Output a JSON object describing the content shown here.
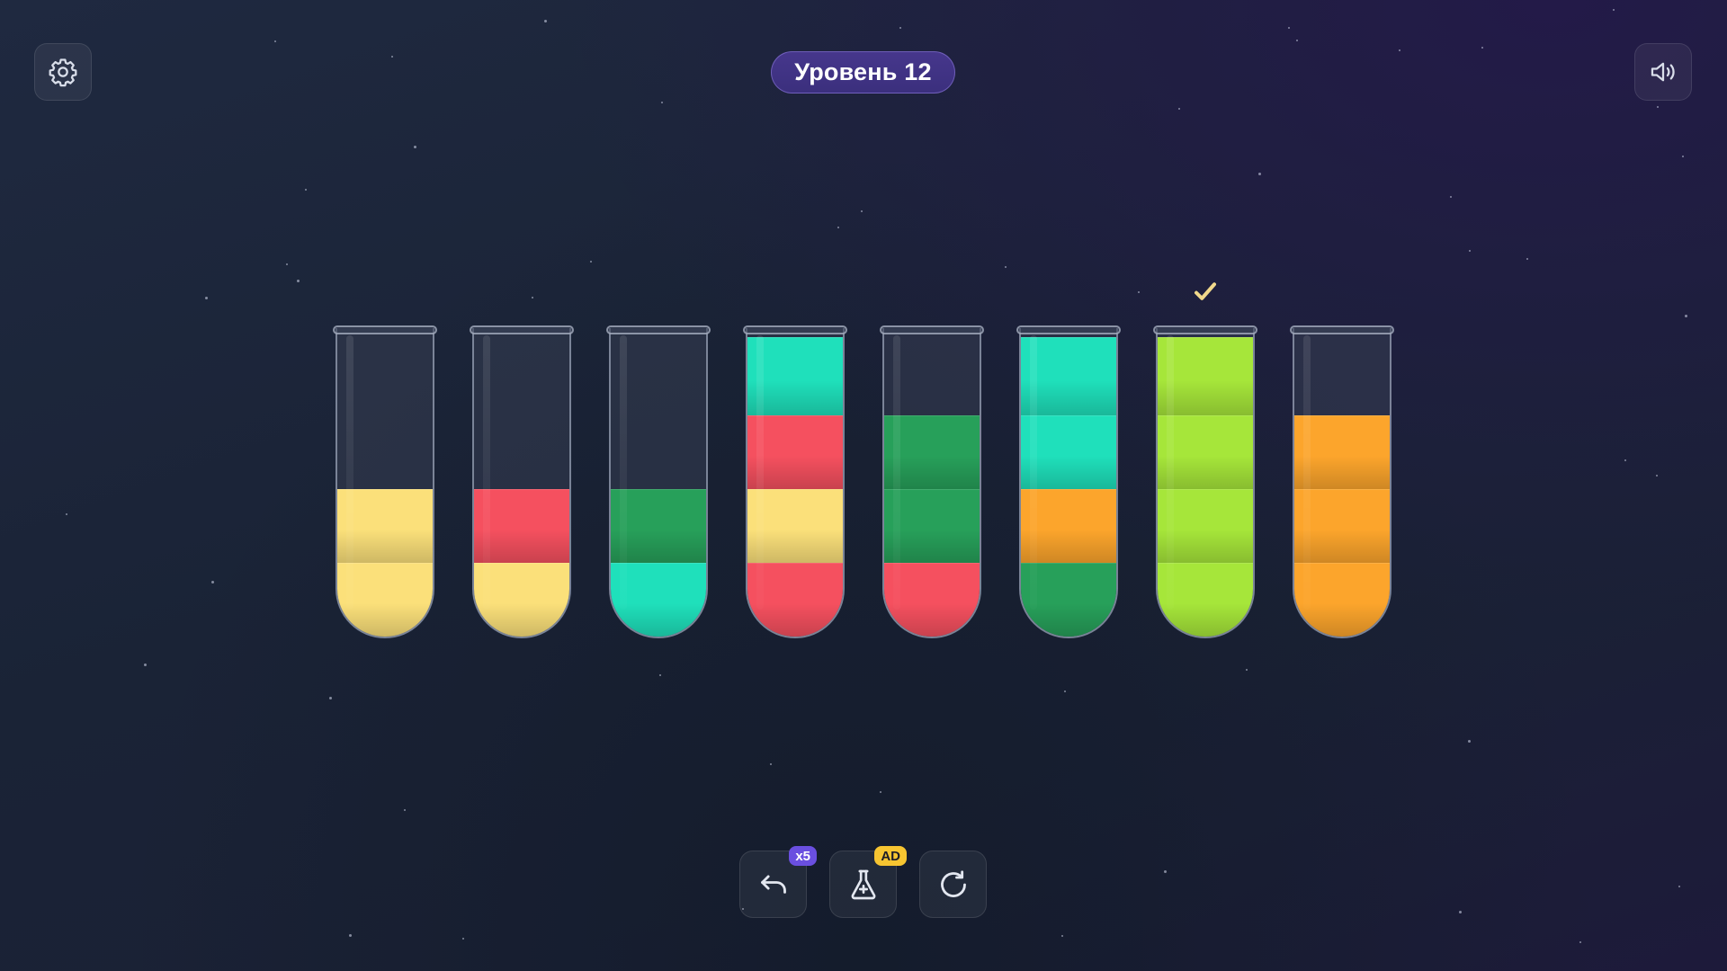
{
  "header": {
    "level_label": "Уровень 12"
  },
  "icons": {
    "settings": "gear-icon",
    "sound": "speaker-icon",
    "undo": "undo-arrow-icon",
    "hint": "flask-plus-icon",
    "restart": "restart-icon",
    "check": "checkmark-icon"
  },
  "colors": {
    "yellow": "#fbe07a",
    "red": "#f5505f",
    "dark_green": "#27a05a",
    "teal": "#1fe0bb",
    "orange": "#fca52c",
    "lime": "#a6e63a",
    "check": "#f1d88b"
  },
  "tubes": [
    {
      "layers": [
        "yellow",
        "yellow"
      ],
      "completed": false
    },
    {
      "layers": [
        "yellow",
        "red"
      ],
      "completed": false
    },
    {
      "layers": [
        "teal",
        "dark_green"
      ],
      "completed": false
    },
    {
      "layers": [
        "red",
        "yellow",
        "red",
        "teal"
      ],
      "completed": false
    },
    {
      "layers": [
        "red",
        "dark_green",
        "dark_green"
      ],
      "completed": false
    },
    {
      "layers": [
        "dark_green",
        "orange",
        "teal",
        "teal"
      ],
      "completed": false
    },
    {
      "layers": [
        "lime",
        "lime",
        "lime",
        "lime"
      ],
      "completed": true
    },
    {
      "layers": [
        "orange",
        "orange",
        "orange"
      ],
      "completed": false
    }
  ],
  "controls": {
    "undo_badge": "x5",
    "hint_badge": "AD"
  }
}
